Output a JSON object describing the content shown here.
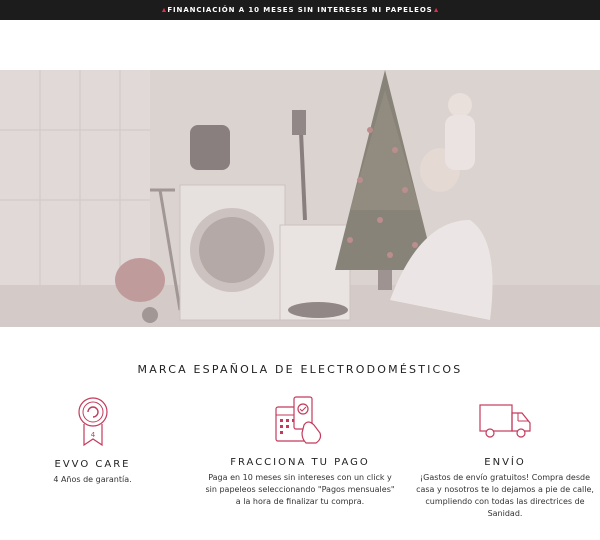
{
  "announcement": {
    "text": "FINANCIACIÓN A 10 MESES SIN INTERESES NI PAPELEOS",
    "accent_color": "#d8304a"
  },
  "hero": {
    "description_color": "#d9cfcd"
  },
  "section": {
    "title": "MARCA ESPAÑOLA DE ELECTRODOMÉSTICOS"
  },
  "features": [
    {
      "icon": "medal-4-years-icon",
      "title": "EVVO CARE",
      "text": "4 Años de garantía.",
      "badge_text": "4"
    },
    {
      "icon": "phone-calendar-payment-icon",
      "title": "FRACCIONA TU PAGO",
      "text": "Paga en 10 meses sin intereses con un click y sin papeleos seleccionando \"Pagos mensuales\" a la hora de finalizar tu compra."
    },
    {
      "icon": "delivery-truck-icon",
      "title": "ENVÍO",
      "text": "¡Gastos de envío gratuitos! Compra desde casa y nosotros te lo dejamos a pie de calle, cumpliendo con todas las directrices de Sanidad."
    }
  ],
  "icon_color": "#c43a5c"
}
